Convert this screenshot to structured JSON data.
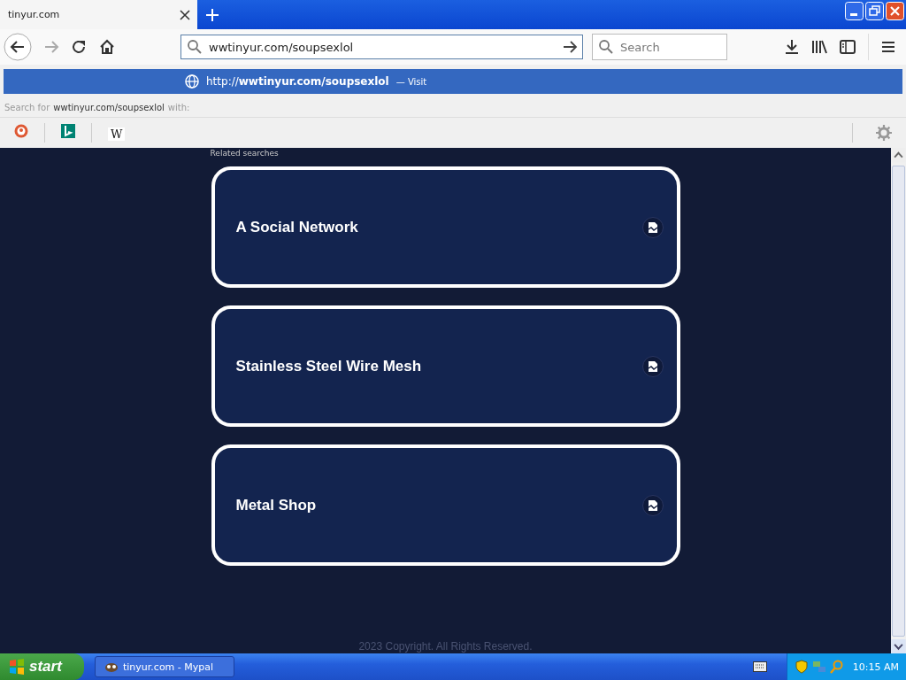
{
  "tab": {
    "title": "tinyur.com",
    "selected": true
  },
  "address_bar": {
    "value": "wwtinyur.com/soupsexlol"
  },
  "search": {
    "placeholder": "Search"
  },
  "suggestion": {
    "url": "http://**wwtinyur.com/soupsexlol**",
    "action": "— Visit"
  },
  "search_with": {
    "prefix": "Search for",
    "term": "wwtinyur.com/soupsexlol",
    "suffix": "with:"
  },
  "engines": [
    {
      "kind": "duck"
    },
    {
      "kind": "bing"
    },
    {
      "kind": "wiki",
      "label": "W"
    }
  ],
  "page": {
    "heading": "Related searches",
    "results": [
      {
        "title": "A Social Network"
      },
      {
        "title": "Stainless Steel Wire Mesh"
      },
      {
        "title": "Metal Shop"
      }
    ],
    "footer": "2023 Copyright. All Rights Reserved."
  },
  "taskbar": {
    "start": "start",
    "task": "tinyur.com - Mypal",
    "clock": "10:15 AM"
  }
}
